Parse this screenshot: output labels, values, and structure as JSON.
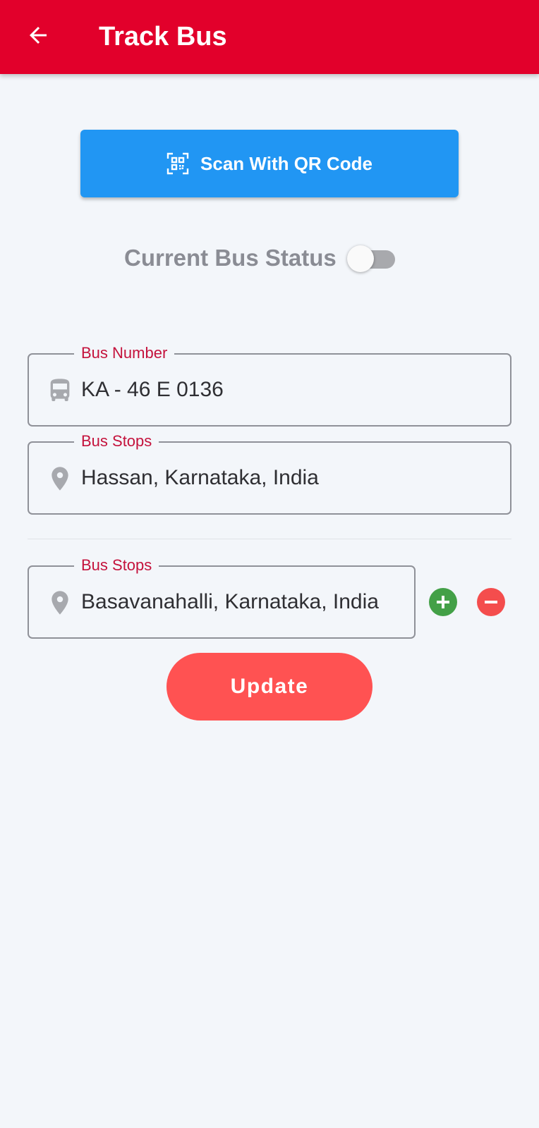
{
  "appbar": {
    "title": "Track Bus",
    "back_icon": "arrow-back-icon",
    "color": "#e2002b"
  },
  "scan_button": {
    "label": "Scan With QR Code",
    "icon": "qr-scan-icon",
    "color": "#2196f3"
  },
  "bus_status": {
    "label": "Current Bus Status",
    "toggle_on": false
  },
  "bus_number": {
    "label": "Bus Number",
    "value": "KA - 46 E 0136",
    "icon": "bus-icon"
  },
  "stops": [
    {
      "label": "Bus Stops",
      "value": "Hassan, Karnataka, India",
      "icon": "location-pin-icon"
    },
    {
      "label": "Bus Stops",
      "value": "Basavanahalli, Karnataka, India",
      "icon": "location-pin-icon",
      "add_icon": "add-circle-icon",
      "remove_icon": "remove-circle-icon"
    }
  ],
  "update_button": {
    "label": "Update",
    "color": "#ff5252"
  },
  "colors": {
    "accent_label": "#c4123c",
    "add": "#43a047",
    "remove": "#f44d4d"
  }
}
